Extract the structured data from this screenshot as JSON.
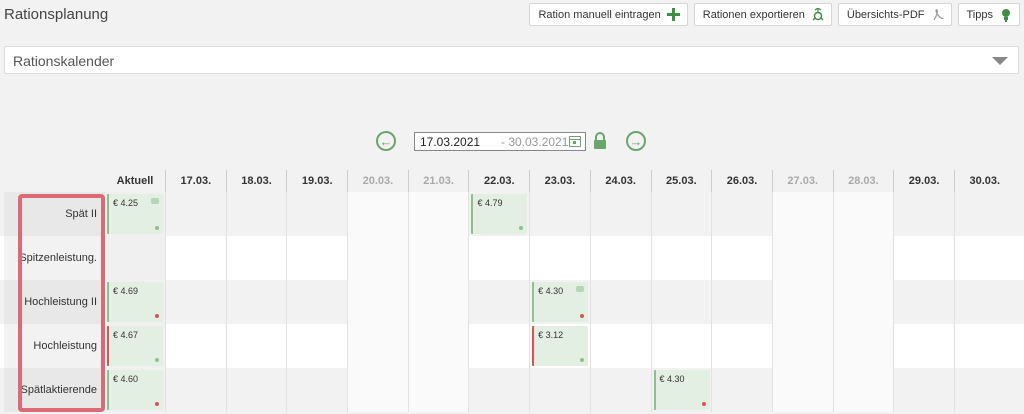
{
  "page": {
    "title": "Rationsplanung"
  },
  "toolbar": {
    "buttons": [
      {
        "label": "Ration manuell eintragen",
        "icon": "plus-icon"
      },
      {
        "label": "Rationen exportieren",
        "icon": "export-icon"
      },
      {
        "label": "Übersichts-PDF",
        "icon": "pdf-icon"
      },
      {
        "label": "Tipps",
        "icon": "lightbulb-icon"
      }
    ]
  },
  "accordion": {
    "label": "Rationskalender"
  },
  "range": {
    "from": "17.03.2021",
    "to": "- 30.03.2021"
  },
  "columns": [
    "Aktuell",
    "17.03.",
    "18.03.",
    "19.03.",
    "20.03.",
    "21.03.",
    "22.03.",
    "23.03.",
    "24.03.",
    "25.03.",
    "26.03.",
    "27.03.",
    "28.03.",
    "29.03.",
    "30.03."
  ],
  "rows": [
    {
      "label": "Spät II",
      "current": "€ 4.25",
      "entries": {
        "22.03.": "€ 4.79"
      }
    },
    {
      "label": "Spitzenleistung.",
      "current": "",
      "entries": {}
    },
    {
      "label": "Hochleistung II",
      "current": "€ 4.69",
      "entries": {
        "23.03.": "€ 4.30"
      }
    },
    {
      "label": "Hochleistung",
      "current": "€ 4.67",
      "entries": {
        "23.03.": "€ 3.12"
      }
    },
    {
      "label": "Spätlaktierende",
      "current": "€ 4.60",
      "entries": {
        "25.03.": "€ 4.30"
      }
    }
  ],
  "colors": {
    "accent": "#6aa56d",
    "highlight": "#dc6a74",
    "alert": "#d9534f"
  }
}
